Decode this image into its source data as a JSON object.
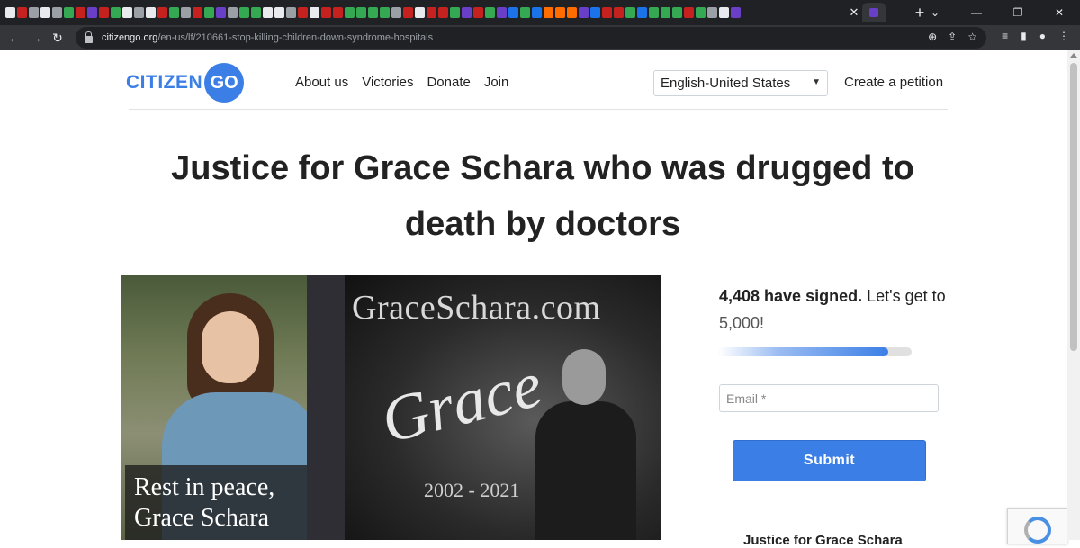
{
  "browser": {
    "url_host": "citizengo.org",
    "url_path": "/en-us/lf/210661-stop-killing-children-down-syndrome-hospitals",
    "tab_favicon_colors": [
      "#e8eaed",
      "#c5221f",
      "#9aa0a6",
      "#e8eaed",
      "#9aa0a6",
      "#34a853",
      "#c5221f",
      "#6a3fc8",
      "#c5221f",
      "#34a853",
      "#e8eaed",
      "#9aa0a6",
      "#e8eaed",
      "#c5221f",
      "#34a853",
      "#9aa0a6",
      "#c5221f",
      "#34a853",
      "#6a3fc8",
      "#9aa0a6",
      "#34a853",
      "#34a853",
      "#e8eaed",
      "#e8eaed",
      "#9aa0a6",
      "#c5221f",
      "#e8eaed",
      "#c5221f",
      "#c5221f",
      "#34a853",
      "#34a853",
      "#34a853",
      "#34a853",
      "#9aa0a6",
      "#c5221f",
      "#e8eaed",
      "#c5221f",
      "#c5221f",
      "#34a853",
      "#6a3fc8",
      "#c5221f",
      "#34a853",
      "#6a3fc8",
      "#1a73e8",
      "#34a853",
      "#1a73e8",
      "#ff6d00",
      "#ff6d00",
      "#ff6d00",
      "#6a3fc8",
      "#1a73e8",
      "#c5221f",
      "#c5221f",
      "#34a853",
      "#1a73e8",
      "#34a853",
      "#34a853",
      "#34a853",
      "#c5221f",
      "#34a853",
      "#9aa0a6",
      "#e8eaed",
      "#6a3fc8"
    ],
    "tab_close": "✕",
    "new_tab": "+",
    "window_controls": [
      "⌄",
      "—",
      "❐",
      "✕"
    ]
  },
  "header": {
    "logo_text": "CITIZEN",
    "logo_circle_text": "GO",
    "nav": [
      "About us",
      "Victories",
      "Donate",
      "Join"
    ],
    "language": "English-United States",
    "create_petition": "Create a petition"
  },
  "petition": {
    "title": "Justice for Grace Schara who was drugged to death by doctors",
    "image": {
      "caption_line1": "Rest in peace,",
      "caption_line2": "Grace Schara",
      "site_name": "GraceSchara.com",
      "script_name": "Grace",
      "years": "2002 - 2021"
    }
  },
  "signing": {
    "signed_count": "4,408 have signed.",
    "goal_prefix": "Let's get to",
    "goal_number": "5,000!",
    "progress_fraction": 0.88,
    "email_placeholder": "Email *",
    "submit_label": "Submit",
    "next_heading_partial": "Justice for Grace Schara"
  },
  "colors": {
    "brand_blue": "#3b7fe6"
  }
}
